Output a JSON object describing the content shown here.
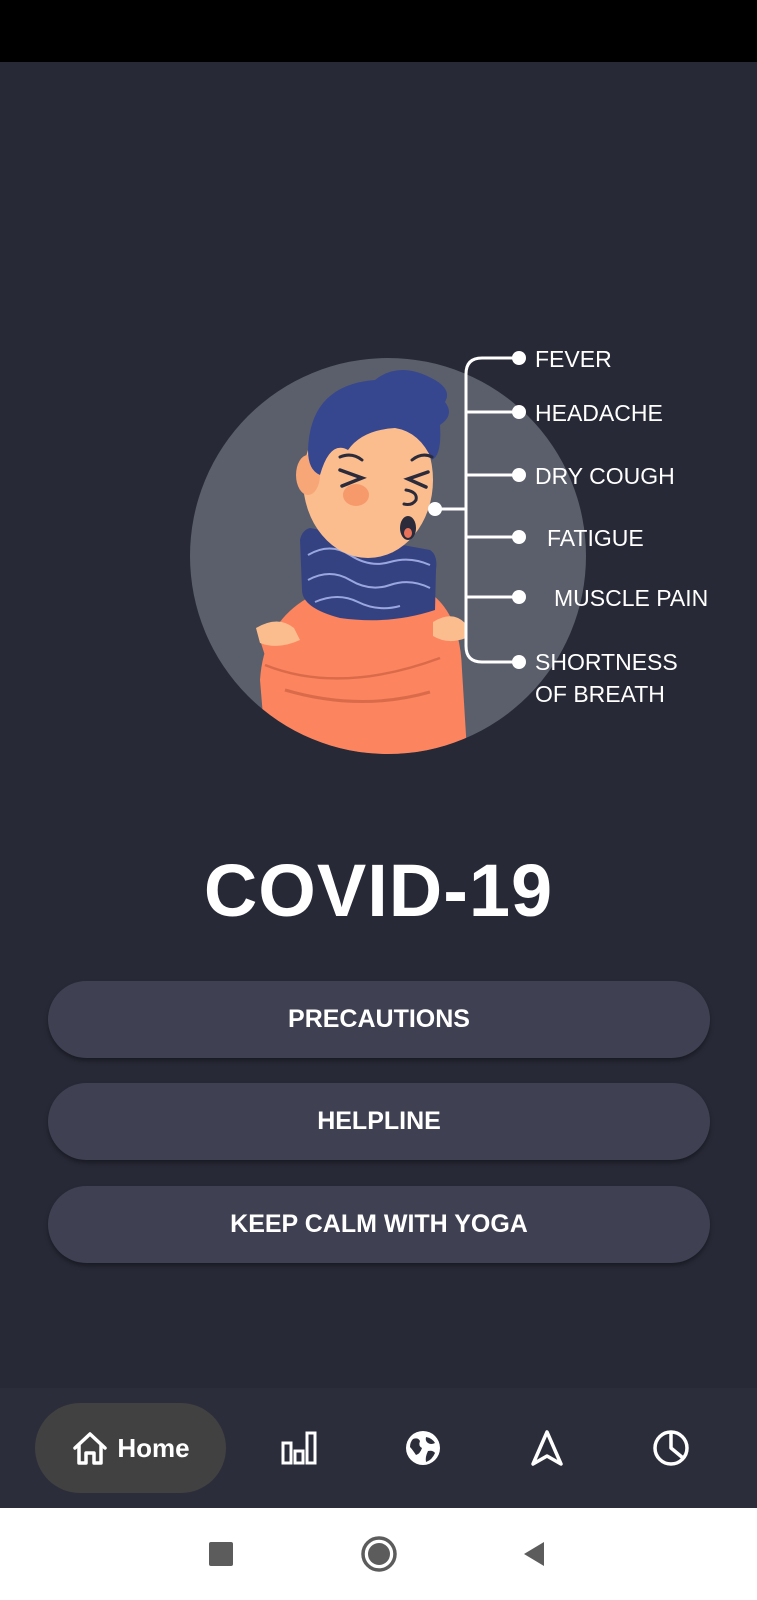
{
  "title": "COVID-19",
  "symptoms": [
    "FEVER",
    "HEADACHE",
    "DRY COUGH",
    "FATIGUE",
    "MUSCLE PAIN",
    "SHORTNESS",
    "OF BREATH"
  ],
  "buttons": {
    "precautions": "PRECAUTIONS",
    "helpline": "HELPLINE",
    "yoga": "KEEP CALM WITH YOGA"
  },
  "bottom_nav": {
    "home_label": "Home",
    "active": "home",
    "icons": [
      "home-icon",
      "bar-chart-icon",
      "globe-icon",
      "navigation-icon",
      "pie-chart-icon"
    ]
  },
  "system_nav": {
    "icons": [
      "recents-icon",
      "home-circle-icon",
      "back-icon"
    ]
  },
  "colors": {
    "background": "#272936",
    "button": "#3f4052",
    "nav_active": "#414141",
    "circle": "#5b5f6b",
    "sweater": "#fc845f",
    "scarf": "#354282",
    "hair": "#36478f",
    "skin": "#fbbd8e"
  }
}
